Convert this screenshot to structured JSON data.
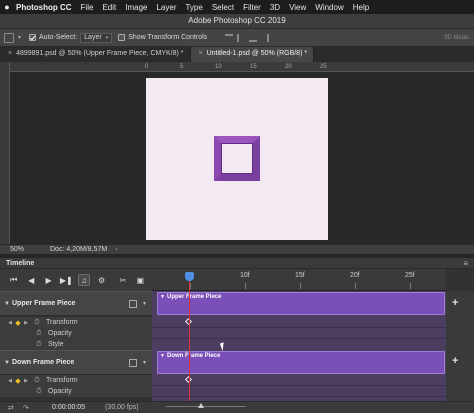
{
  "menubar": {
    "apple": "",
    "app_name": "Photoshop CC",
    "items": [
      "File",
      "Edit",
      "Image",
      "Layer",
      "Type",
      "Select",
      "Filter",
      "3D",
      "View",
      "Window",
      "Help"
    ]
  },
  "window": {
    "title": "Adobe Photoshop CC 2019"
  },
  "options_bar": {
    "auto_select_label": "Auto-Select:",
    "auto_select_checked": true,
    "auto_select_value": "Layer",
    "show_transform_label": "Show Transform Controls",
    "show_transform_checked": false,
    "mode_3d_label": "3D Mode:"
  },
  "doc_tabs": [
    {
      "label": "4899891.psd @ 50% (Upper Frame Piece, CMYK/8) *",
      "active": false
    },
    {
      "label": "Untitled-1.psd @ 50% (RGB/8) *",
      "active": true
    }
  ],
  "ruler_ticks": [
    "0",
    "5",
    "10",
    "15",
    "20",
    "25"
  ],
  "status_bar": {
    "zoom": "50%",
    "doc_info": "Doc: 4,20M/8,57M",
    "arrow": "›"
  },
  "colors": {
    "canvas_bg": "#f3e9f3",
    "frame": "#7b3fa0",
    "clip": "#7a4fb8",
    "playhead": "#e0303a",
    "playhead_head": "#4e8fe4",
    "keyframe": "#f0c020"
  },
  "timeline": {
    "title": "Timeline",
    "menu_icon": "menu-icon",
    "controls": [
      "first-frame-icon",
      "prev-frame-icon",
      "play-icon",
      "next-frame-icon",
      "audio-icon",
      "settings-icon",
      "split-icon",
      "transition-icon"
    ],
    "frame_labels": [
      "10f",
      "15f",
      "20f",
      "25f"
    ],
    "layers": [
      {
        "name": "Upper Frame Piece",
        "clip_label": "Upper Frame Piece",
        "properties": [
          {
            "name": "Transform",
            "has_keyframe": true
          },
          {
            "name": "Opacity",
            "has_keyframe": false
          },
          {
            "name": "Style",
            "has_keyframe": false
          }
        ]
      },
      {
        "name": "Down Frame Piece",
        "clip_label": "Down Frame Piece",
        "properties": [
          {
            "name": "Transform",
            "has_keyframe": true
          },
          {
            "name": "Opacity",
            "has_keyframe": false
          }
        ]
      }
    ],
    "add_button": "+",
    "timecode": "0:00:00:05",
    "fps": "(30,00 fps)"
  }
}
